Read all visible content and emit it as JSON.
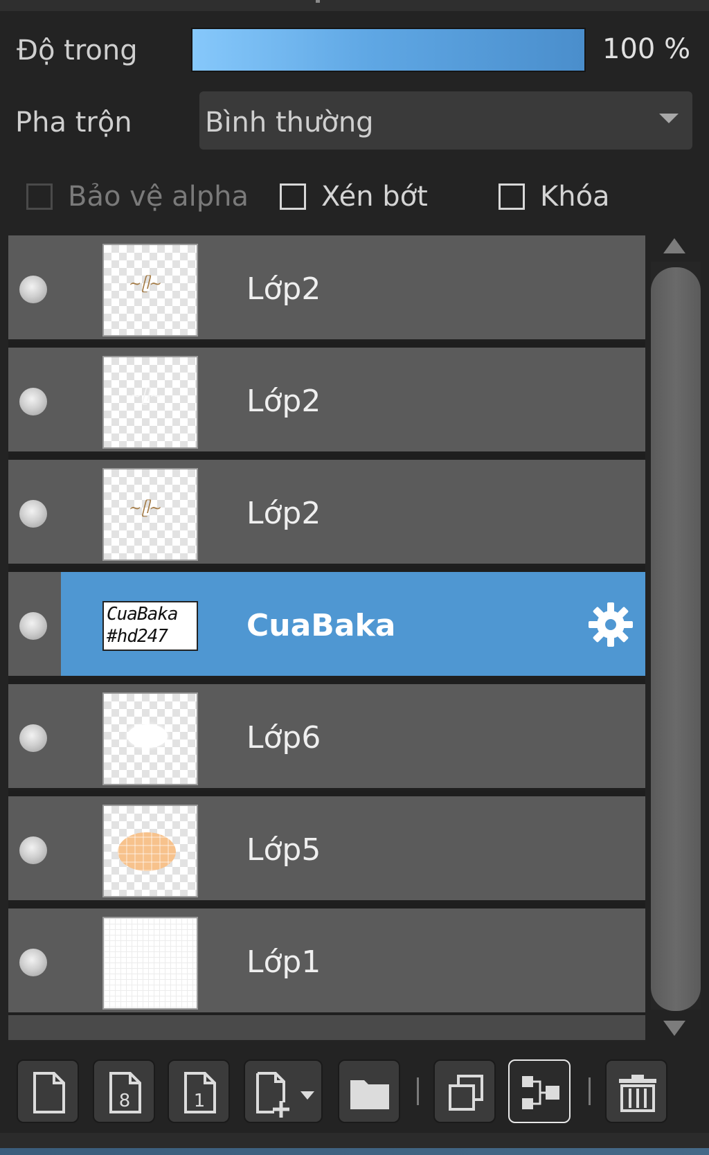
{
  "properties": {
    "opacity_label": "Độ trong",
    "opacity_value": "100 %",
    "opacity_percent": 100,
    "blend_label": "Pha trộn",
    "blend_value": "Bình thường",
    "checkboxes": {
      "protect_alpha": "Bảo vệ alpha",
      "clip": "Xén bớt",
      "lock": "Khóa"
    }
  },
  "layers": [
    {
      "name": "Lớp2",
      "thumb": "checker-brown-script"
    },
    {
      "name": "Lớp2",
      "thumb": "checker-white-script"
    },
    {
      "name": "Lớp2",
      "thumb": "checker-brown-script"
    },
    {
      "name": "CuaBaka",
      "thumb": "text",
      "thumb_text_1": "CuaBaka",
      "thumb_text_2": "#hd247",
      "selected": true
    },
    {
      "name": "Lớp6",
      "thumb": "checker-white-blob"
    },
    {
      "name": "Lớp5",
      "thumb": "checker-peach-ellipse"
    },
    {
      "name": "Lớp1",
      "thumb": "white-grid"
    }
  ],
  "icons": {
    "visibility": "eye-dot-icon",
    "settings": "gear-icon",
    "scroll_up": "arrow-up-icon",
    "scroll_down": "arrow-down-icon"
  },
  "toolbar": {
    "buttons": [
      {
        "name": "new-layer-button",
        "icon": "new-page-icon"
      },
      {
        "name": "new-8bit-layer-button",
        "icon": "page-8-icon",
        "glyph": "8"
      },
      {
        "name": "new-1bit-layer-button",
        "icon": "page-1-icon",
        "glyph": "1"
      },
      {
        "name": "add-layer-menu-button",
        "icon": "page-plus-dropdown-icon"
      },
      {
        "name": "new-folder-button",
        "icon": "folder-icon"
      },
      {
        "name": "duplicate-layer-button",
        "icon": "duplicate-icon"
      },
      {
        "name": "merge-down-button",
        "icon": "merge-icon"
      },
      {
        "name": "delete-layer-button",
        "icon": "trash-icon"
      }
    ]
  },
  "colors": {
    "selection": "#4f97d2",
    "row": "#5b5b5b",
    "background": "#232323",
    "opacity_bar_start": "#86c8fb",
    "opacity_bar_end": "#4a8ecc"
  }
}
